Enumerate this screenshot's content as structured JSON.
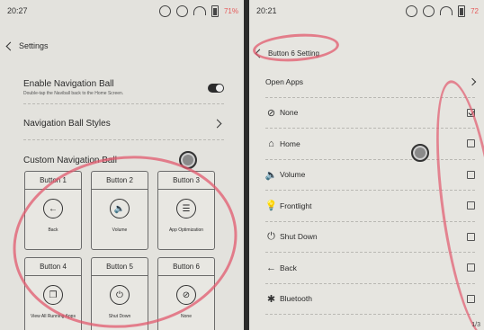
{
  "left": {
    "status_time": "20:27",
    "battery": "71%",
    "header_title": "Settings",
    "enable_nav": {
      "title": "Enable Navigation Ball",
      "subtitle": "Double-tap the Naviball back to the Home Screen."
    },
    "nav_styles": {
      "title": "Navigation Ball Styles"
    },
    "custom_nav": {
      "title": "Custom Navigation Ball"
    },
    "buttons": [
      {
        "title": "Button 1",
        "icon": "arrow-left-icon",
        "glyph": "←",
        "label": "Back"
      },
      {
        "title": "Button 2",
        "icon": "volume-icon",
        "glyph": "🔈",
        "label": "Volume"
      },
      {
        "title": "Button 3",
        "icon": "sliders-icon",
        "glyph": "☰",
        "label": "App Optimization"
      },
      {
        "title": "Button 4",
        "icon": "recent-apps-icon",
        "glyph": "❐",
        "label": "View All Running Apps"
      },
      {
        "title": "Button 5",
        "icon": "power-icon",
        "glyph": "⏻",
        "label": "Shut Down"
      },
      {
        "title": "Button 6",
        "icon": "none-icon",
        "glyph": "⊘",
        "label": "None"
      }
    ]
  },
  "right": {
    "status_time": "20:21",
    "battery": "72",
    "header_title": "Button 6 Setting",
    "options": [
      {
        "label": "Open Apps",
        "icon": "",
        "glyph": "",
        "control": "chevron",
        "checked": false
      },
      {
        "label": "None",
        "icon": "none-icon",
        "glyph": "⊘",
        "control": "checkbox",
        "checked": true
      },
      {
        "label": "Home",
        "icon": "home-icon",
        "glyph": "⌂",
        "control": "checkbox",
        "checked": false
      },
      {
        "label": "Volume",
        "icon": "volume-icon",
        "glyph": "🔈",
        "control": "checkbox",
        "checked": false
      },
      {
        "label": "Frontlight",
        "icon": "bulb-icon",
        "glyph": "💡",
        "control": "checkbox",
        "checked": false
      },
      {
        "label": "Shut Down",
        "icon": "power-icon",
        "glyph": "⏻",
        "control": "checkbox",
        "checked": false
      },
      {
        "label": "Back",
        "icon": "arrow-left-icon",
        "glyph": "←",
        "control": "checkbox",
        "checked": false
      },
      {
        "label": "Bluetooth",
        "icon": "bluetooth-icon",
        "glyph": "✱",
        "control": "checkbox",
        "checked": false
      }
    ],
    "page_indicator": "1/3"
  },
  "colors": {
    "annotation": "#e15a6e",
    "background": "#e4e3de"
  }
}
